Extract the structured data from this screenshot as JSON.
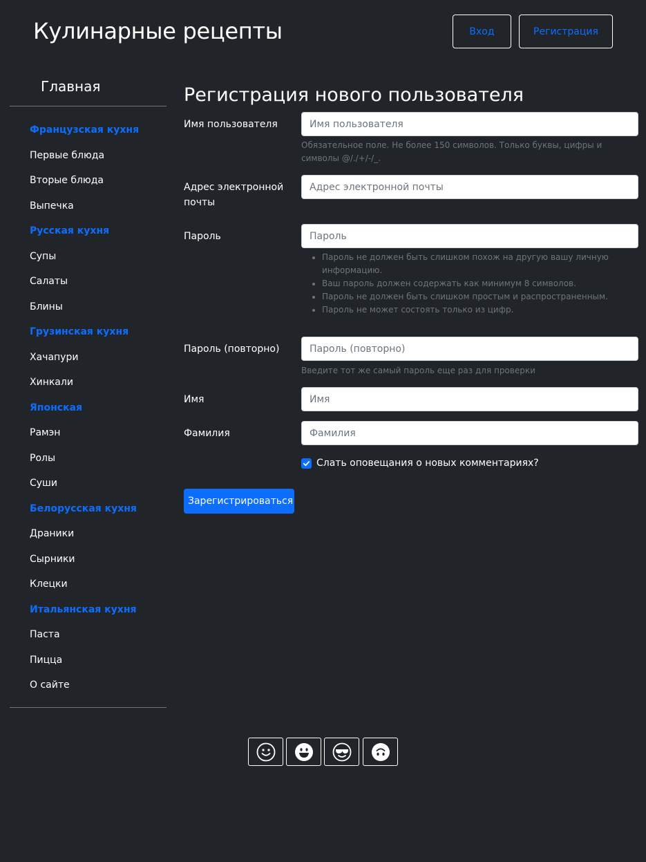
{
  "header": {
    "site_title": "Кулинарные рецепты",
    "login_label": "Вход",
    "register_label": "Регистрация"
  },
  "sidebar": {
    "home_label": "Главная",
    "items": [
      {
        "label": "Французская кухня",
        "type": "category"
      },
      {
        "label": "Первые блюда",
        "type": "item"
      },
      {
        "label": "Вторые блюда",
        "type": "item"
      },
      {
        "label": "Выпечка",
        "type": "item"
      },
      {
        "label": "Русская кухня",
        "type": "category"
      },
      {
        "label": "Супы",
        "type": "item"
      },
      {
        "label": "Салаты",
        "type": "item"
      },
      {
        "label": "Блины",
        "type": "item"
      },
      {
        "label": "Грузинская кухня",
        "type": "category"
      },
      {
        "label": "Хачапури",
        "type": "item"
      },
      {
        "label": "Хинкали",
        "type": "item"
      },
      {
        "label": "Японская",
        "type": "category"
      },
      {
        "label": "Рамэн",
        "type": "item"
      },
      {
        "label": "Ролы",
        "type": "item"
      },
      {
        "label": "Суши",
        "type": "item"
      },
      {
        "label": "Белорусская кухня",
        "type": "category"
      },
      {
        "label": "Драники",
        "type": "item"
      },
      {
        "label": "Сырники",
        "type": "item"
      },
      {
        "label": "Клецки",
        "type": "item"
      },
      {
        "label": "Итальянская кухня",
        "type": "category"
      },
      {
        "label": "Паста",
        "type": "item"
      },
      {
        "label": "Пицца",
        "type": "item"
      },
      {
        "label": "О сайте",
        "type": "item"
      }
    ]
  },
  "form": {
    "title": "Регистрация нового пользователя",
    "username": {
      "label": "Имя пользователя",
      "placeholder": "Имя пользователя",
      "value": "",
      "help": "Обязательное поле. Не более 150 символов. Только буквы, цифры и символы @/./+/-/_."
    },
    "email": {
      "label": "Адрес электронной почты",
      "placeholder": "Адрес электронной почты",
      "value": ""
    },
    "password": {
      "label": "Пароль",
      "placeholder": "Пароль",
      "value": "",
      "help_items": [
        "Пароль не должен быть слишком похож на другую вашу личную информацию.",
        "Ваш пароль должен содержать как минимум 8 символов.",
        "Пароль не должен быть слишком простым и распространенным.",
        "Пароль не может состоять только из цифр."
      ]
    },
    "password2": {
      "label": "Пароль (повторно)",
      "placeholder": "Пароль (повторно)",
      "value": "",
      "help": "Введите тот же самый пароль еще раз для проверки"
    },
    "first_name": {
      "label": "Имя",
      "placeholder": "Имя",
      "value": ""
    },
    "last_name": {
      "label": "Фамилия",
      "placeholder": "Фамилия",
      "value": ""
    },
    "notify": {
      "label": "Слать оповещания о новых комментариях?",
      "checked": true
    },
    "submit_label": "Зарегистрироваться"
  },
  "theme_buttons": [
    {
      "icon": "smile-icon"
    },
    {
      "icon": "grin-icon"
    },
    {
      "icon": "sunglasses-face-icon"
    },
    {
      "icon": "upside-down-face-icon"
    }
  ],
  "colors": {
    "background": "#212529",
    "accent": "#0d6efd",
    "muted": "#6c757d",
    "text": "#ffffff"
  }
}
